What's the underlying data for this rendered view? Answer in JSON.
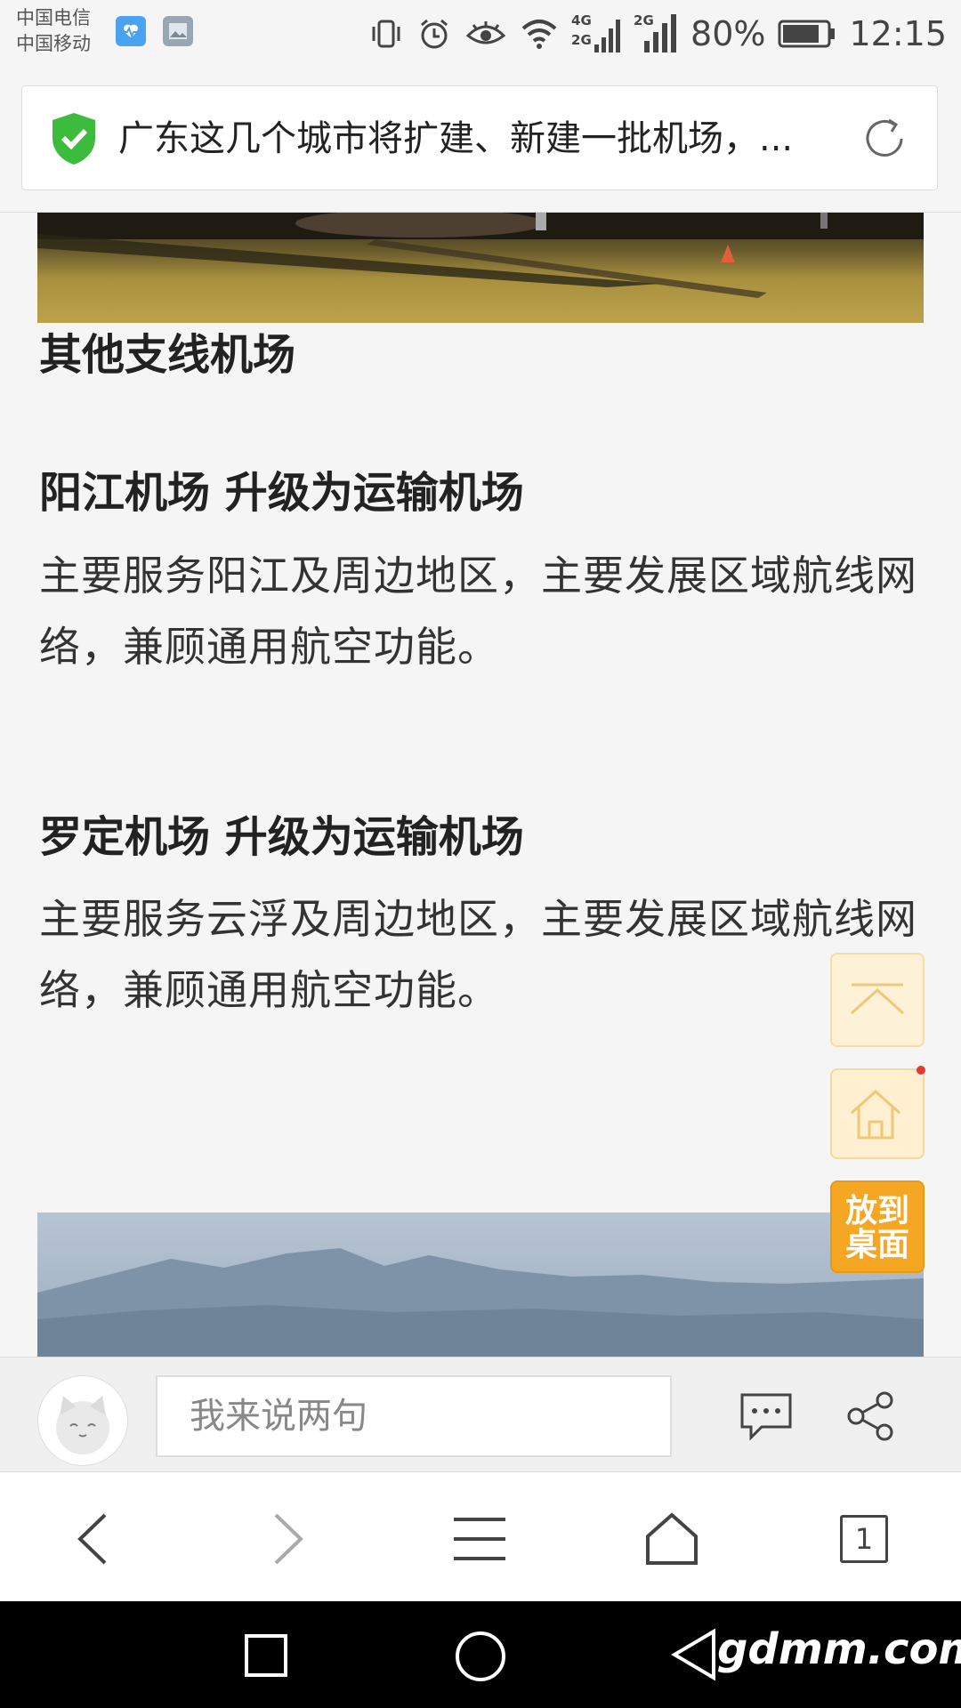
{
  "status_bar": {
    "carrier_1": "中国电信",
    "carrier_2": "中国移动",
    "net_1": "4G",
    "net_2": "2G",
    "net_3": "2G",
    "battery": "80%",
    "time": "12:15"
  },
  "url_bar": {
    "title": "广东这几个城市将扩建、新建一批机场，..."
  },
  "article": {
    "heading_other": "其他支线机场",
    "yangjiang": {
      "heading": "阳江机场 升级为运输机场",
      "body": "主要服务阳江及周边地区，主要发展区域航线网络，兼顾通用航空功能。"
    },
    "luoding": {
      "heading": "罗定机场 升级为运输机场",
      "body": "主要服务云浮及周边地区，主要发展区域航线网络，兼顾通用航空功能。"
    }
  },
  "floating": {
    "desktop_label_1": "放到",
    "desktop_label_2": "桌面"
  },
  "comment_bar": {
    "placeholder": "我来说两句"
  },
  "browser_nav": {
    "tab_count": "1"
  },
  "watermark": "gdmm.com",
  "colors": {
    "accent_orange": "#f5a623",
    "shield_green": "#3dbb3d"
  }
}
